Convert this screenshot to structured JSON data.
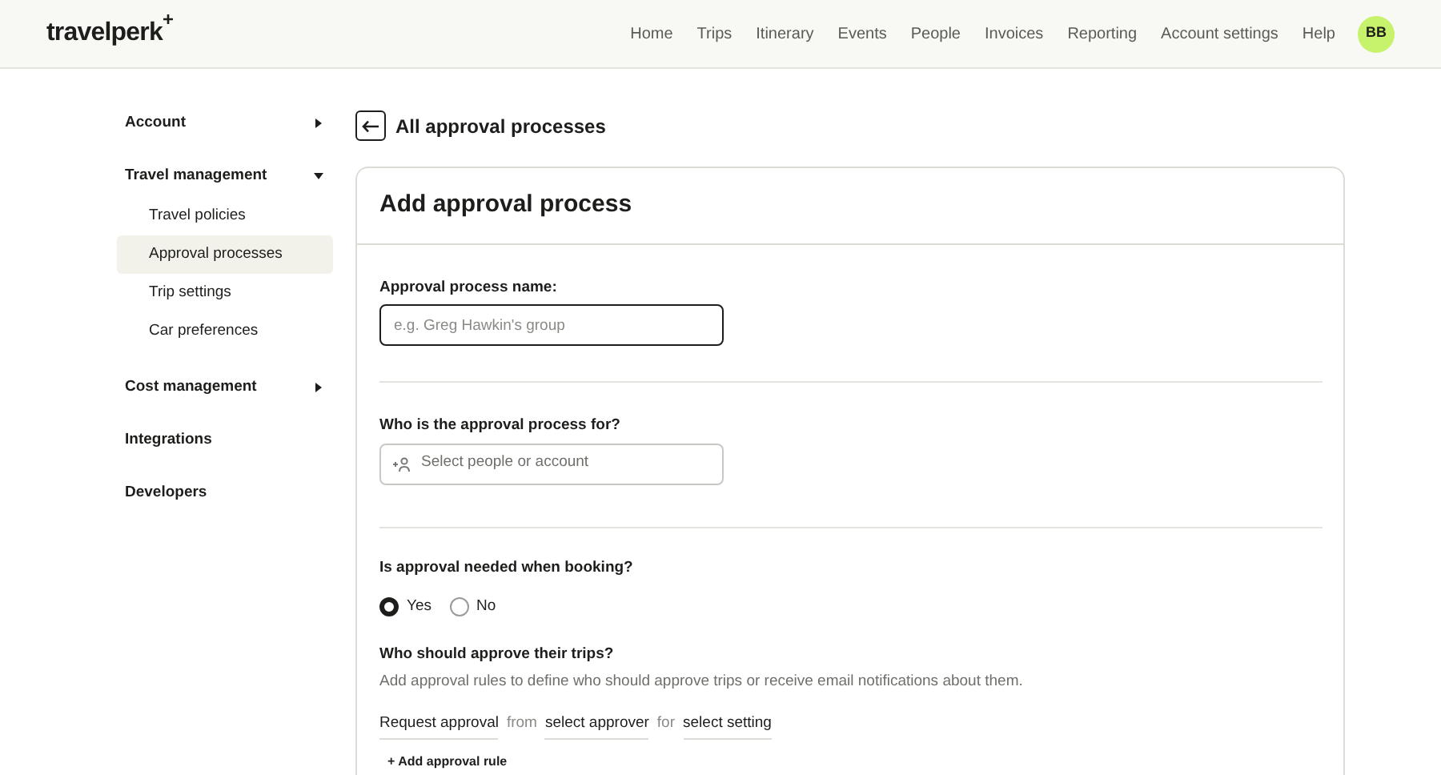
{
  "header": {
    "logo": "travelperk",
    "logo_mark": "+",
    "nav": [
      "Home",
      "Trips",
      "Itinerary",
      "Events",
      "People",
      "Invoices",
      "Reporting",
      "Account settings",
      "Help"
    ],
    "avatar": "BB"
  },
  "sidebar": {
    "items": [
      {
        "label": "Account",
        "kind": "expandable",
        "expanded": false
      },
      {
        "label": "Travel management",
        "kind": "expandable",
        "expanded": true,
        "children": [
          {
            "label": "Travel policies",
            "selected": false
          },
          {
            "label": "Approval processes",
            "selected": true
          },
          {
            "label": "Trip settings",
            "selected": false
          },
          {
            "label": "Car preferences",
            "selected": false
          }
        ]
      },
      {
        "label": "Cost management",
        "kind": "expandable",
        "expanded": false
      },
      {
        "label": "Integrations",
        "kind": "link"
      },
      {
        "label": "Developers",
        "kind": "link"
      }
    ]
  },
  "back_link": {
    "label": "All approval processes"
  },
  "form": {
    "title": "Add approval process",
    "name_field": {
      "label": "Approval process name:",
      "placeholder": "e.g. Greg Hawkin's group"
    },
    "for_field": {
      "label": "Who is the approval process for?",
      "placeholder": "Select people or account"
    },
    "booking_question": {
      "label": "Is approval needed when booking?",
      "options": [
        {
          "label": "Yes",
          "selected": true
        },
        {
          "label": "No",
          "selected": false
        }
      ]
    },
    "approvers": {
      "heading": "Who should approve their trips?",
      "description": "Add approval rules to define who should approve trips or receive email notifications about them.",
      "rule": [
        {
          "kind": "select",
          "text": "Request approval"
        },
        {
          "kind": "word",
          "text": "from"
        },
        {
          "kind": "select",
          "text": "select approver"
        },
        {
          "kind": "word",
          "text": "for"
        },
        {
          "kind": "select",
          "text": "select setting"
        }
      ],
      "add_rule": "+ Add approval rule"
    }
  }
}
